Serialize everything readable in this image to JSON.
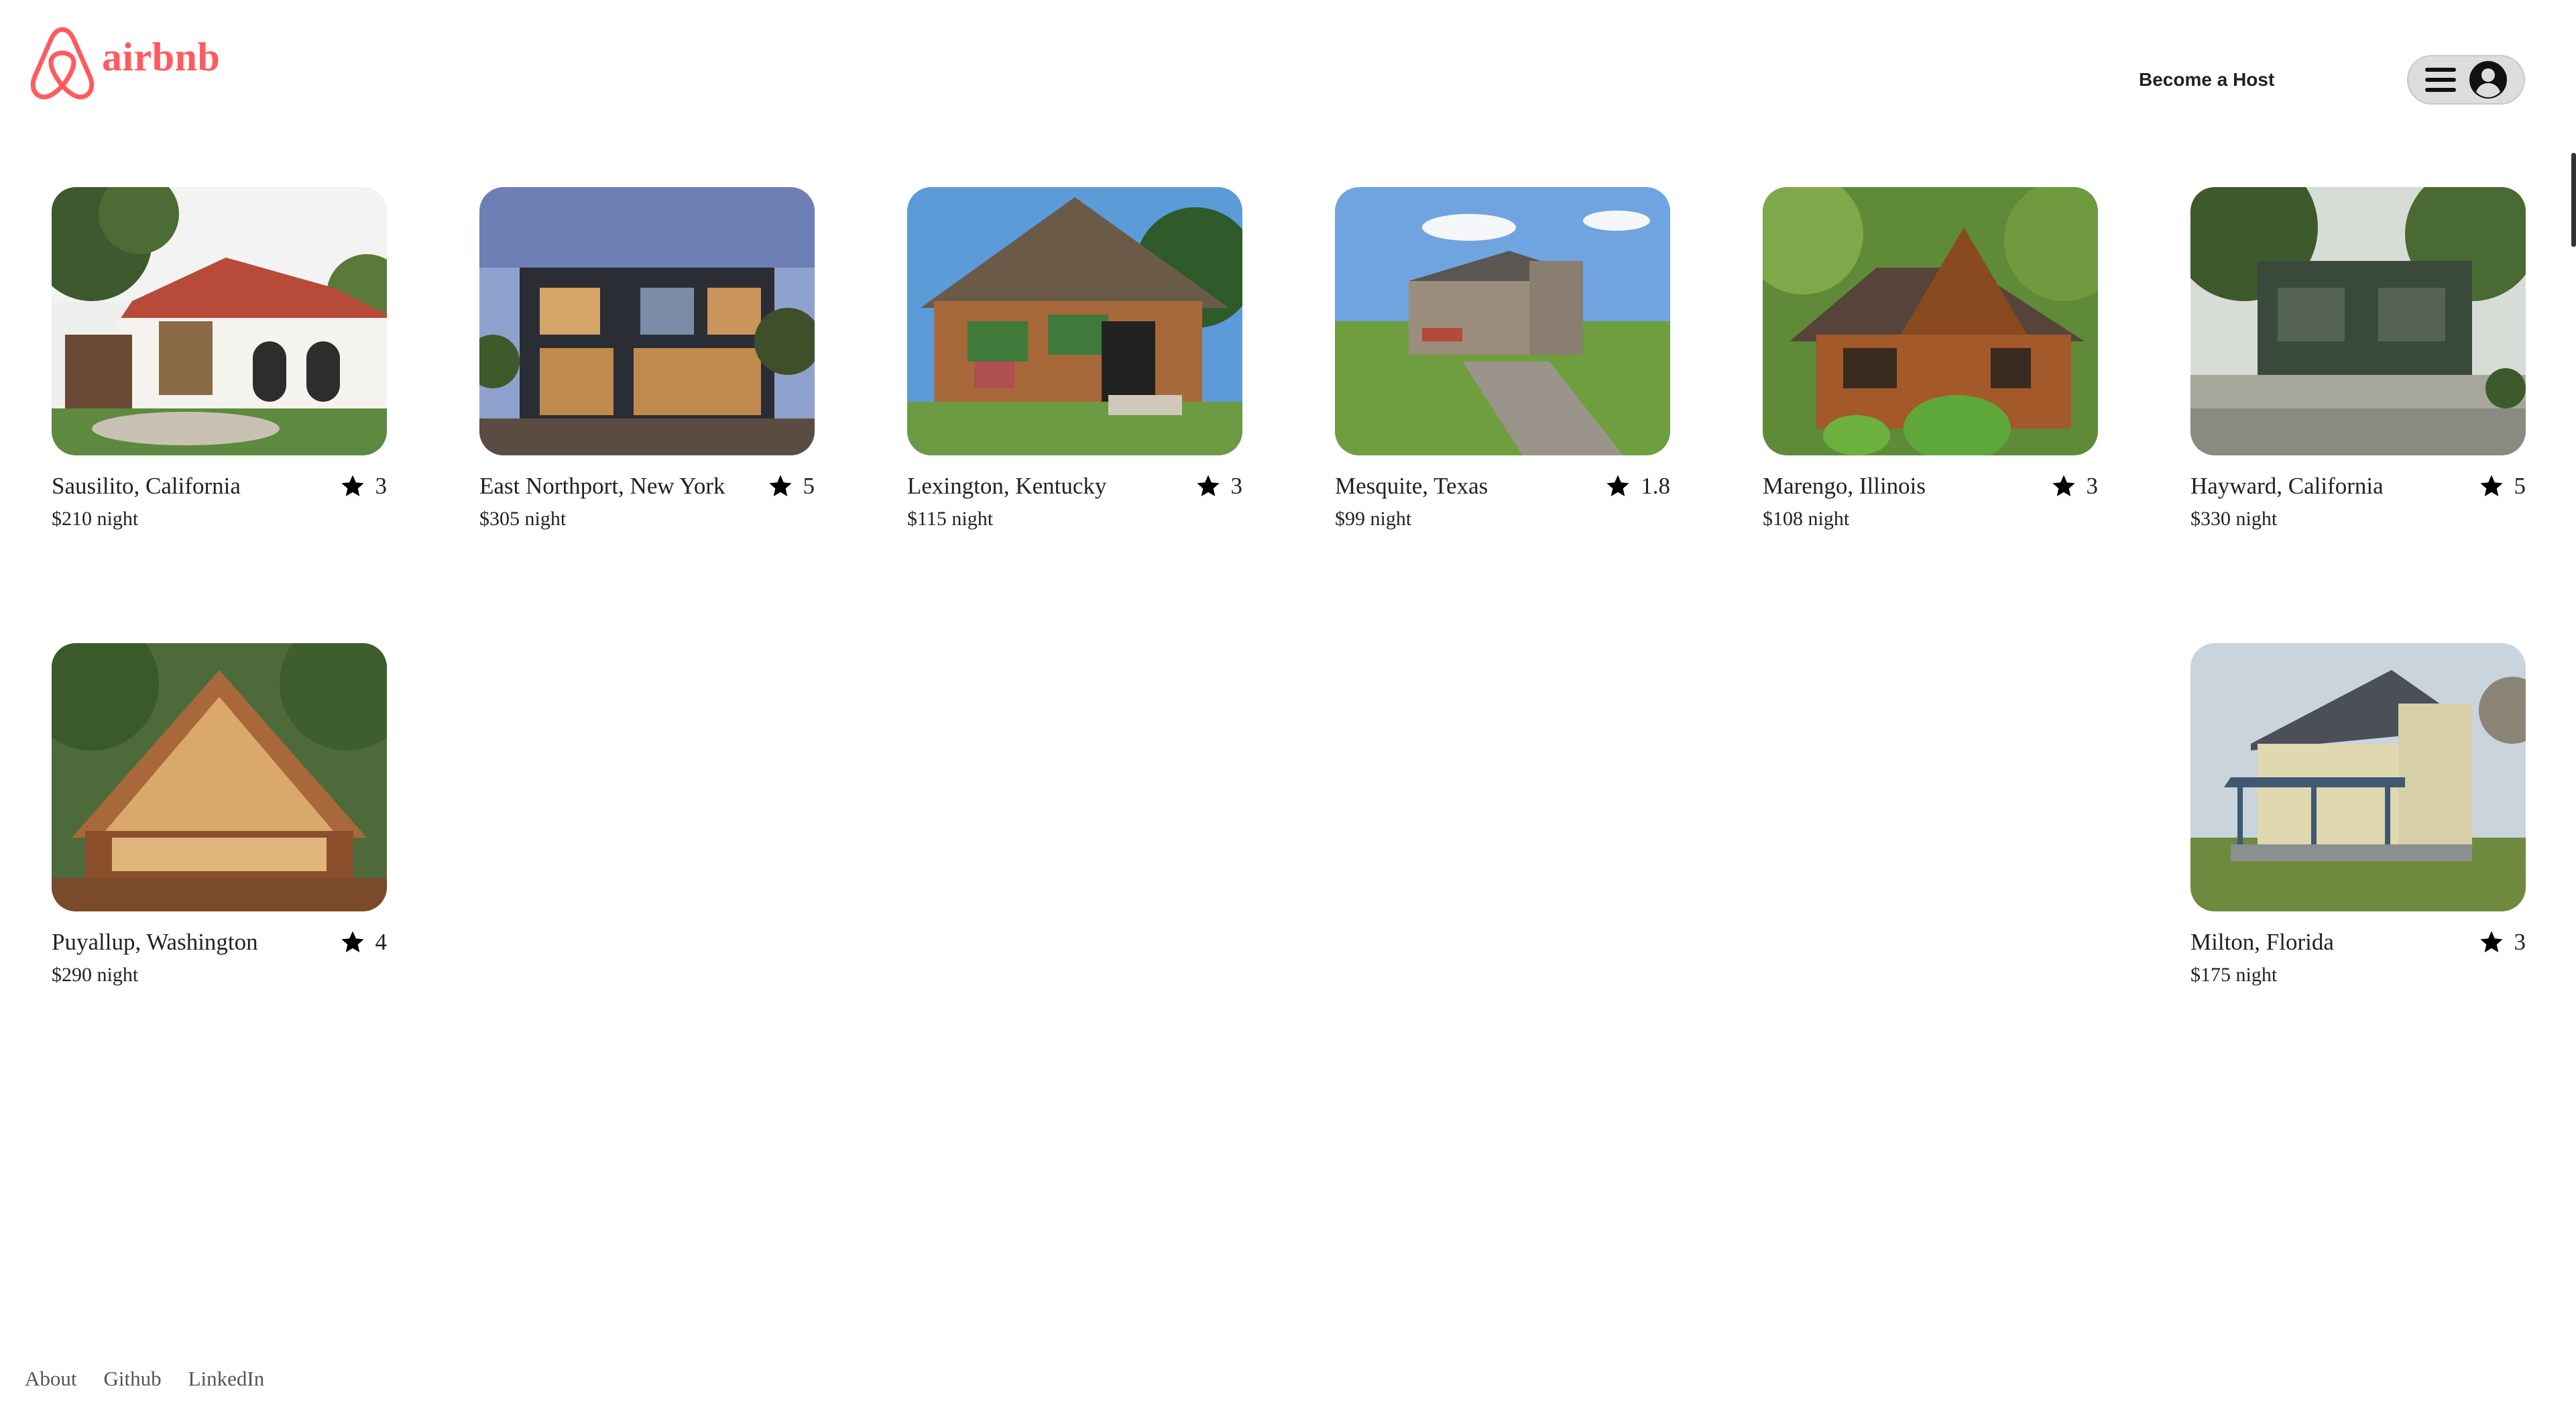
{
  "brand": {
    "name": "airbnb",
    "accent_color": "#ff5a5f",
    "logo_icon": "airbnb-belo-icon"
  },
  "header": {
    "become_host_label": "Become a Host",
    "menu_icon": "hamburger-icon",
    "profile_icon": "user-circle-icon"
  },
  "listings": [
    {
      "location": "Sausilito, California",
      "rating": "3",
      "price": "$210 night"
    },
    {
      "location": "East Northport, New York",
      "rating": "5",
      "price": "$305 night"
    },
    {
      "location": "Lexington, Kentucky",
      "rating": "3",
      "price": "$115 night"
    },
    {
      "location": "Mesquite, Texas",
      "rating": "1.8",
      "price": "$99 night"
    },
    {
      "location": "Marengo, Illinois",
      "rating": "3",
      "price": "$108 night"
    },
    {
      "location": "Hayward, California",
      "rating": "5",
      "price": "$330 night"
    },
    {
      "location": "Puyallup, Washington",
      "rating": "4",
      "price": "$290 night"
    },
    {
      "location": "Milton, Florida",
      "rating": "3",
      "price": "$175 night"
    }
  ],
  "rating_icon": "star-icon",
  "footer": {
    "links": [
      "About",
      "Github",
      "LinkedIn"
    ]
  }
}
